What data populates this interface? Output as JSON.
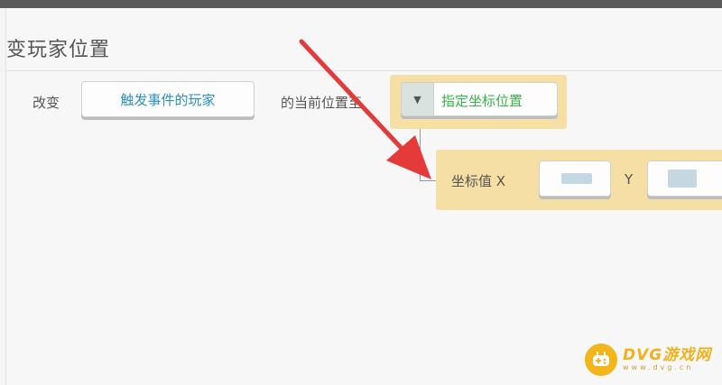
{
  "title": "变玩家位置",
  "row": {
    "prefix_label": "改变",
    "player_button_label": "触发事件的玩家",
    "middle_label": "的当前位置至",
    "position_dropdown": {
      "selected": "指定坐标位置",
      "arrow_glyph": "▼"
    }
  },
  "coords": {
    "label": "坐标值 X",
    "y_label": "Y"
  },
  "watermark": {
    "name": "DVG游戏网",
    "url": "www.dvg.cn"
  },
  "colors": {
    "highlight_bg": "#f6dfa4",
    "link_blue": "#2a8fbf",
    "value_green": "#39b24a",
    "arrow_red": "#e53a3a",
    "watermark_gold": "#f3b51a"
  }
}
